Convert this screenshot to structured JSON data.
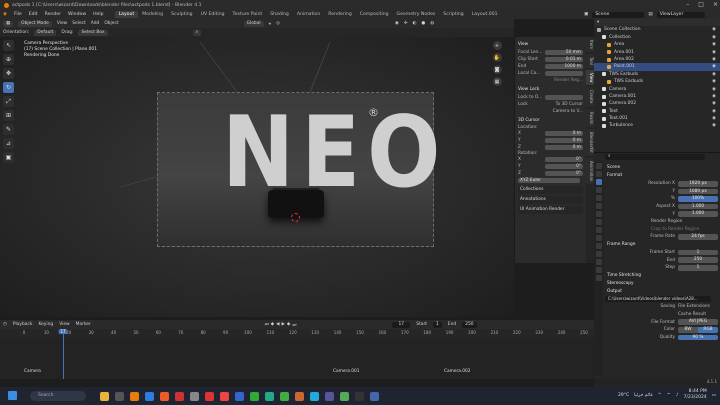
{
  "window": {
    "title": "actpods 1 [C:\\Users\\wizard\\Downloads\\blender files\\actpods 1.blend] - Blender 4.1"
  },
  "menu": [
    "File",
    "Edit",
    "Render",
    "Window",
    "Help"
  ],
  "workspaces": [
    "Layout",
    "Modeling",
    "Sculpting",
    "UV Editing",
    "Texture Paint",
    "Shading",
    "Animation",
    "Rendering",
    "Compositing",
    "Geometry Nodes",
    "Scripting",
    "Layout.001"
  ],
  "scene": {
    "label": "Scene",
    "view_layer": "ViewLayer"
  },
  "viewport_header": {
    "mode": "Object Mode",
    "menus": [
      "View",
      "Select",
      "Add",
      "Object"
    ],
    "orientation_label": "Orientation:",
    "orientation": "Default",
    "drag_label": "Drag:",
    "drag": "Select Box",
    "pivot": "Global"
  },
  "viewport_info": {
    "line1": "Camera Perspective",
    "line2": "(17) Scene Collection | Plane.001",
    "line3": "Rendering Done"
  },
  "neo_text": "NEO",
  "npanel": {
    "view_title": "View",
    "focal_length_label": "Focal Len...",
    "focal_length": "50 mm",
    "clip_start_label": "Clip Start",
    "clip_start": "0.01 m",
    "end_label": "End",
    "end": "1000 m",
    "local_camera_label": "Local Ca...",
    "render_region": "Render Reg...",
    "view_lock_title": "View Lock",
    "lock_to_object": "Lock to O...",
    "lock_label": "Lock",
    "to_3d_cursor": "To 3D Cursor",
    "camera_to_view": "Camera to V...",
    "cursor_title": "3D Cursor",
    "location_label": "Location:",
    "loc": [
      {
        "axis": "X",
        "val": "0 m"
      },
      {
        "axis": "Y",
        "val": "0 m"
      },
      {
        "axis": "Z",
        "val": "0 m"
      }
    ],
    "rotation_label": "Rotation:",
    "rot": [
      {
        "axis": "X",
        "val": "0°"
      },
      {
        "axis": "Y",
        "val": "0°"
      },
      {
        "axis": "Z",
        "val": "0°"
      }
    ],
    "rot_mode": "XYZ Euler",
    "collections": "Collections",
    "annotations": "Annotations",
    "ui_anim": "UI Animation Render"
  },
  "side_tabs": [
    "Item",
    "Tool",
    "View",
    "Create",
    "Realm",
    "BlenderKit",
    "Animation"
  ],
  "outliner": {
    "header": "Scene Collection",
    "rows": [
      {
        "name": "Scene Collection",
        "indent": 0,
        "sel": false
      },
      {
        "name": "Collection",
        "indent": 1,
        "sel": false
      },
      {
        "name": "Area",
        "indent": 2,
        "sel": false
      },
      {
        "name": "Area.001",
        "indent": 2,
        "sel": false
      },
      {
        "name": "Area.002",
        "indent": 2,
        "sel": false
      },
      {
        "name": "Point.001",
        "indent": 2,
        "sel": true
      },
      {
        "name": "TWS Earbuds",
        "indent": 1,
        "sel": false
      },
      {
        "name": "TWS Earbuds",
        "indent": 2,
        "sel": false
      },
      {
        "name": "Camera",
        "indent": 1,
        "sel": false
      },
      {
        "name": "Camera.001",
        "indent": 1,
        "sel": false
      },
      {
        "name": "Camera.002",
        "indent": 1,
        "sel": false
      },
      {
        "name": "Text",
        "indent": 1,
        "sel": false
      },
      {
        "name": "Text.001",
        "indent": 1,
        "sel": false
      },
      {
        "name": "Turbulence",
        "indent": 1,
        "sel": false
      }
    ]
  },
  "properties": {
    "scene": "Scene",
    "format_title": "Format",
    "res_x_label": "Resolution X",
    "res_x": "1920 px",
    "res_y_label": "Y",
    "res_y": "1080 px",
    "percent_label": "%",
    "percent": "100%",
    "aspect_x_label": "Aspect X",
    "aspect_x": "1.000",
    "aspect_y_label": "Y",
    "aspect_y": "1.000",
    "render_region": "Render Region",
    "crop": "Crop to Render Region",
    "frame_rate_label": "Frame Rate",
    "frame_rate": "24 fps",
    "frame_range_title": "Frame Range",
    "frame_start_label": "Frame Start",
    "frame_start": "1",
    "end_label": "End",
    "end": "250",
    "step_label": "Step",
    "step": "1",
    "time_stretching": "Time Stretching",
    "stereoscopy": "Stereoscopy",
    "output_title": "Output",
    "output_path": "C:\\Users\\wizard\\Videos\\blender videos\\A28...",
    "saving_label": "Saving",
    "file_ext": "File Extensions",
    "cache_result": "Cache Result",
    "file_format_label": "File Format",
    "file_format": "AVI JPEG",
    "color_label": "Color",
    "color_bw": "BW",
    "color_rgb": "RGB",
    "quality_label": "Quality",
    "quality": "90 %"
  },
  "timeline": {
    "menus": [
      "Playback",
      "Keying",
      "View",
      "Marker"
    ],
    "current_frame": "17",
    "start_label": "Start",
    "start": "1",
    "end_label": "End",
    "end": "250",
    "ticks": [
      "0",
      "10",
      "20",
      "30",
      "40",
      "50",
      "60",
      "70",
      "80",
      "90",
      "100",
      "110",
      "120",
      "130",
      "140",
      "150",
      "160",
      "170",
      "180",
      "190",
      "200",
      "210",
      "220",
      "230",
      "240",
      "250"
    ],
    "markers": [
      "Camera",
      "Camera.001",
      "Camera.002"
    ]
  },
  "status_version": "4.1.1",
  "taskbar": {
    "search": "Search",
    "temp": "29°C",
    "weather": "غائم جزئيا",
    "time": "8:44 PM",
    "date": "7/23/2024"
  },
  "colors": {
    "accent": "#4772b3",
    "blender_orange": "#e87d0d",
    "selection": "#334d80"
  }
}
